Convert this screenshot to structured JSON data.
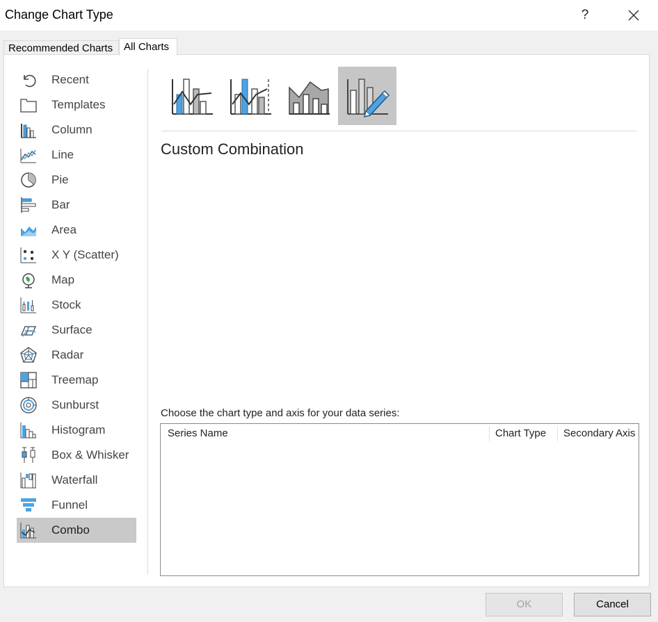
{
  "window": {
    "title": "Change Chart Type",
    "help_label": "?"
  },
  "tabs": [
    {
      "label": "Recommended Charts"
    },
    {
      "label": "All Charts"
    }
  ],
  "sidebar": {
    "items": [
      {
        "label": "Recent",
        "icon": "recent-icon"
      },
      {
        "label": "Templates",
        "icon": "templates-icon"
      },
      {
        "label": "Column",
        "icon": "column-chart-icon"
      },
      {
        "label": "Line",
        "icon": "line-chart-icon"
      },
      {
        "label": "Pie",
        "icon": "pie-chart-icon"
      },
      {
        "label": "Bar",
        "icon": "bar-chart-icon"
      },
      {
        "label": "Area",
        "icon": "area-chart-icon"
      },
      {
        "label": "X Y (Scatter)",
        "icon": "scatter-chart-icon"
      },
      {
        "label": "Map",
        "icon": "map-chart-icon"
      },
      {
        "label": "Stock",
        "icon": "stock-chart-icon"
      },
      {
        "label": "Surface",
        "icon": "surface-chart-icon"
      },
      {
        "label": "Radar",
        "icon": "radar-chart-icon"
      },
      {
        "label": "Treemap",
        "icon": "treemap-chart-icon"
      },
      {
        "label": "Sunburst",
        "icon": "sunburst-chart-icon"
      },
      {
        "label": "Histogram",
        "icon": "histogram-chart-icon"
      },
      {
        "label": "Box & Whisker",
        "icon": "box-whisker-chart-icon"
      },
      {
        "label": "Waterfall",
        "icon": "waterfall-chart-icon"
      },
      {
        "label": "Funnel",
        "icon": "funnel-chart-icon"
      },
      {
        "label": "Combo",
        "icon": "combo-chart-icon"
      }
    ],
    "selected": "Combo"
  },
  "subtypes": [
    {
      "icon": "clustered-column-line-icon"
    },
    {
      "icon": "clustered-column-line-secondary-axis-icon"
    },
    {
      "icon": "stacked-area-clustered-column-icon"
    },
    {
      "icon": "custom-combination-icon"
    }
  ],
  "main": {
    "combo_title": "Custom Combination",
    "choose_label": "Choose the chart type and axis for your data series:",
    "table": {
      "columns": [
        "Series Name",
        "Chart Type",
        "Secondary Axis"
      ],
      "rows": []
    }
  },
  "buttons": {
    "ok": "OK",
    "cancel": "Cancel"
  },
  "colors": {
    "accent": "#4ea3e0",
    "selection_bg": "#c9c9c9"
  }
}
